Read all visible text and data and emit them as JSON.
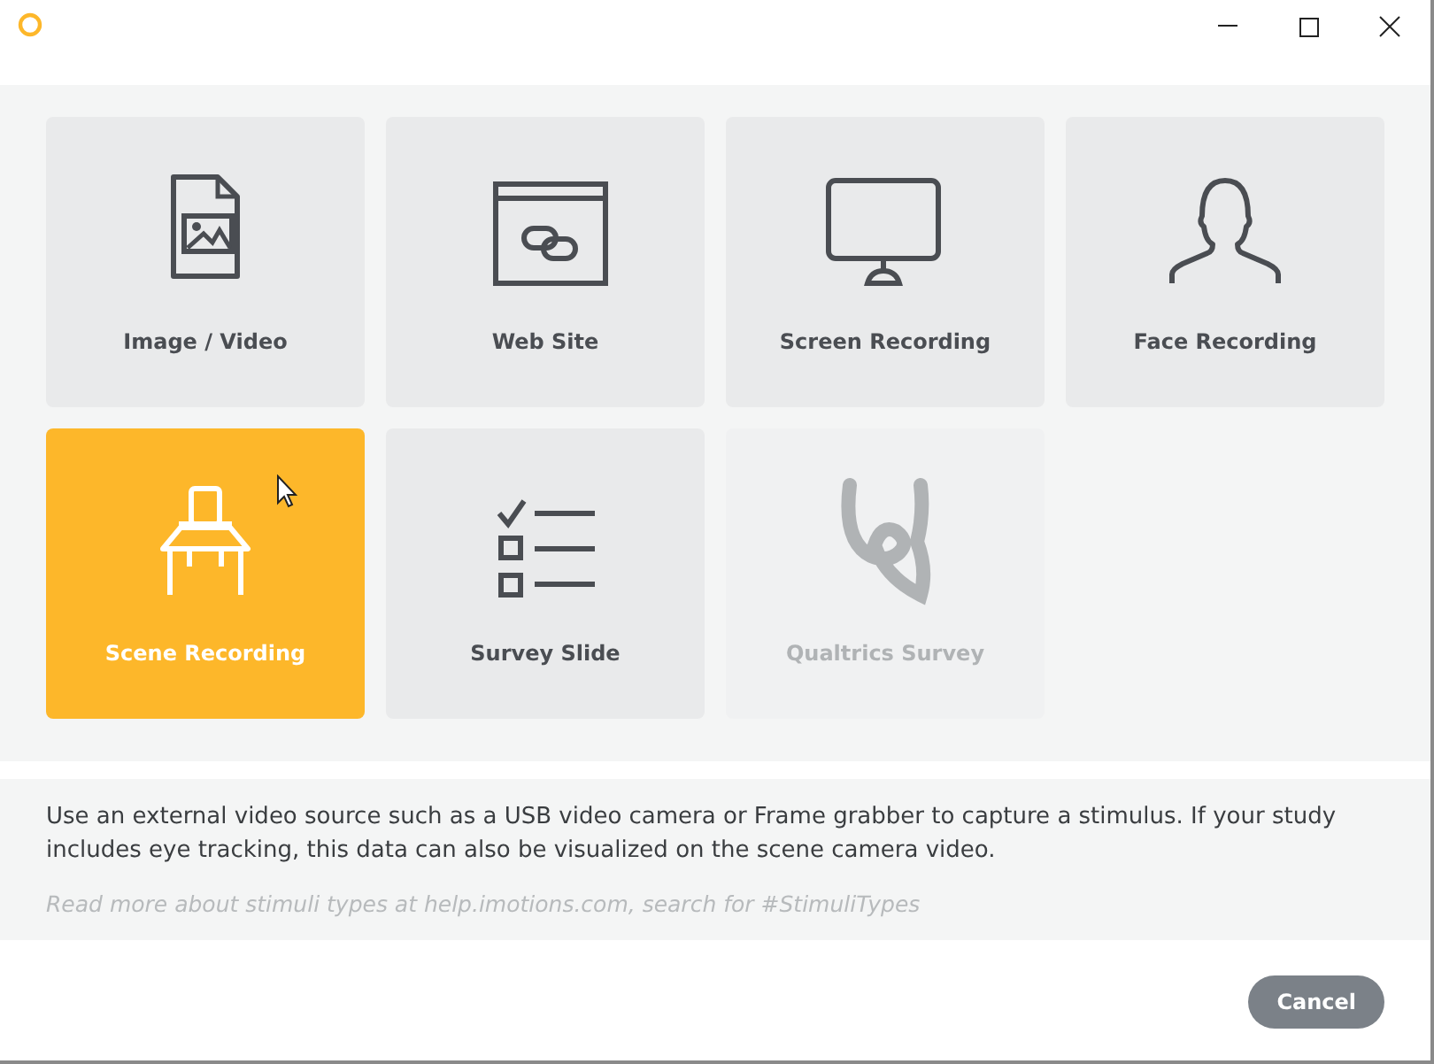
{
  "tiles": [
    {
      "label": "Image / Video",
      "kind": "image",
      "selected": false,
      "disabled": false
    },
    {
      "label": "Web Site",
      "kind": "web",
      "selected": false,
      "disabled": false
    },
    {
      "label": "Screen Recording",
      "kind": "screen",
      "selected": false,
      "disabled": false
    },
    {
      "label": "Face Recording",
      "kind": "face",
      "selected": false,
      "disabled": false
    },
    {
      "label": "Scene Recording",
      "kind": "scene",
      "selected": true,
      "disabled": false
    },
    {
      "label": "Survey Slide",
      "kind": "survey",
      "selected": false,
      "disabled": false
    },
    {
      "label": "Qualtrics Survey",
      "kind": "qualtrics",
      "selected": false,
      "disabled": true
    }
  ],
  "description": "Use an external video source such as a USB video camera or Frame grabber to capture a stimulus. If your study includes eye tracking, this data can also be visualized on the scene camera video.",
  "help_text": "Read more about stimuli types at help.imotions.com, search for #StimuliTypes",
  "buttons": [
    {
      "label": "Cancel"
    }
  ]
}
